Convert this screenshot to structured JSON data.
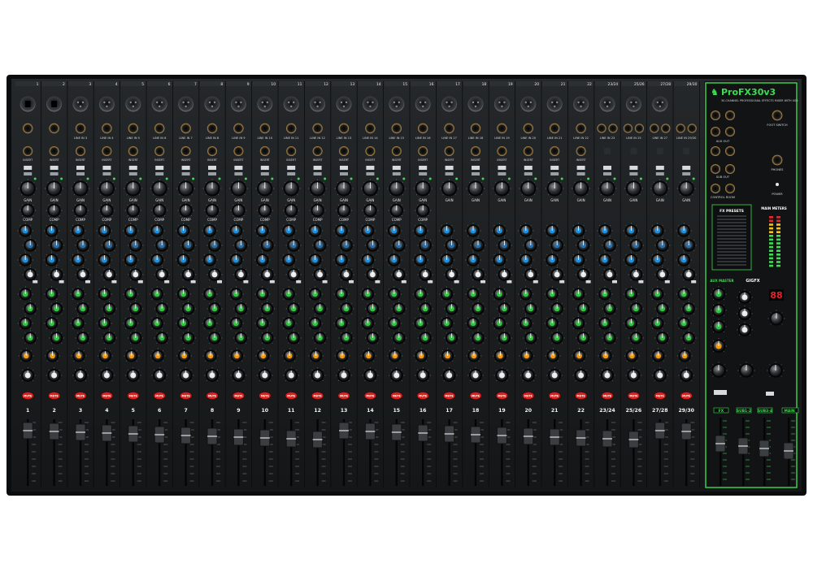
{
  "product": {
    "brand": "ProFX30v3",
    "description": "30-CHANNEL PROFESSIONAL EFFECTS MIXER WITH USB",
    "logo": "mackie-running-man-logo"
  },
  "channels": {
    "count": 26,
    "labels": [
      "1",
      "2",
      "3",
      "4",
      "5",
      "6",
      "7",
      "8",
      "9",
      "10",
      "11",
      "12",
      "13",
      "14",
      "15",
      "16",
      "17",
      "18",
      "19",
      "20",
      "21",
      "22",
      "23/24",
      "25/26",
      "27/28",
      "29/30"
    ],
    "top_labels": [
      "1",
      "2",
      "3",
      "4",
      "5",
      "6",
      "7",
      "8",
      "9",
      "10",
      "11",
      "12",
      "13",
      "14",
      "15",
      "16",
      "17",
      "18",
      "19",
      "20",
      "21",
      "22",
      "23/24",
      "25/26",
      "27/28",
      "29/30"
    ],
    "line_in_labels": [
      "",
      "",
      "LINE IN 3",
      "LINE IN 4",
      "LINE IN 5",
      "LINE IN 6",
      "LINE IN 7",
      "LINE IN 8",
      "LINE IN 9",
      "LINE IN 10",
      "LINE IN 11",
      "LINE IN 12",
      "LINE IN 13",
      "LINE IN 14",
      "LINE IN 15",
      "LINE IN 16",
      "LINE IN 17",
      "LINE IN 18",
      "LINE IN 19",
      "LINE IN 20",
      "LINE IN 21",
      "LINE IN 22",
      "LINE IN 23",
      "LINE IN 25",
      "LINE IN 27",
      "LINE IN 29/30"
    ],
    "gain_label": "GAIN",
    "comp_label": "COMP",
    "mute_label": "MUTE",
    "insert_label": "INSERT"
  },
  "master_section": {
    "fx_presets_title": "FX PRESETS",
    "main_meters_title": "MAIN METERS",
    "aux_master_label": "AUX MASTER",
    "gigfx_label": "GIGFX",
    "foot_switch_label": "FOOT SWITCH",
    "phones_label": "PHONES",
    "aux_out_label": "AUX OUT",
    "sub_out_label": "SUB OUT",
    "control_room_label": "CONTROL ROOM",
    "power_label": "POWER",
    "fader_labels": [
      "FX",
      "SUB1-2",
      "SUB3-4",
      "MAIN"
    ],
    "preset_display": "88"
  },
  "colors": {
    "panel": "#17191a",
    "accent_green": "#3ddc52",
    "knob_blue": "#1f8fe0",
    "knob_green": "#33c442",
    "knob_orange": "#f09a18",
    "mute_red": "#d8211e"
  }
}
